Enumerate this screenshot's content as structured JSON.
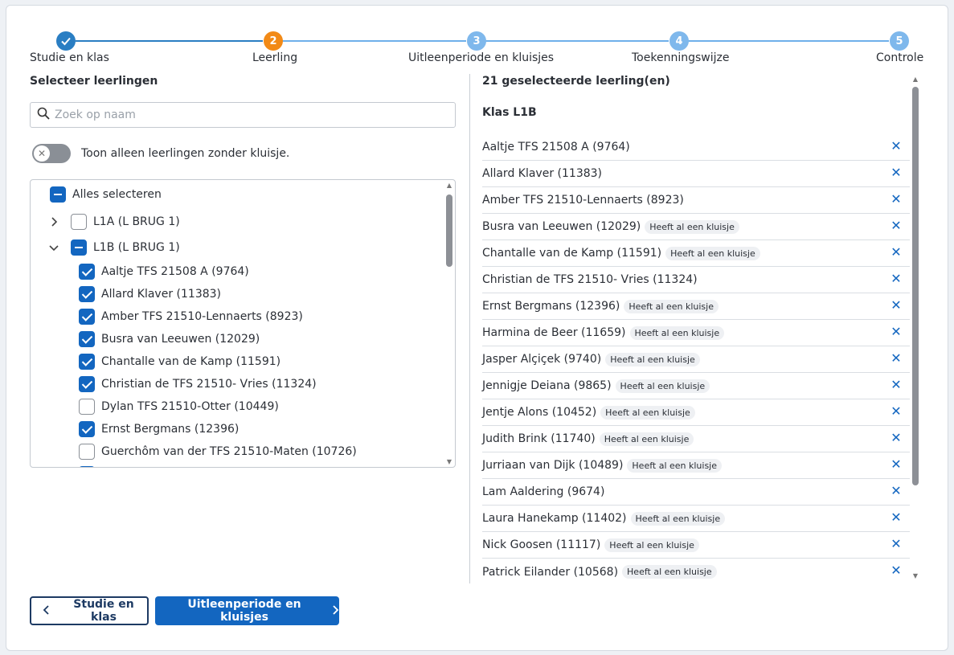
{
  "stepper": {
    "steps": [
      {
        "num": "",
        "label": "Studie en klas",
        "state": "done"
      },
      {
        "num": "2",
        "label": "Leerling",
        "state": "current"
      },
      {
        "num": "3",
        "label": "Uitleenperiode en kluisjes",
        "state": "todo"
      },
      {
        "num": "4",
        "label": "Toekenningswijze",
        "state": "todo"
      },
      {
        "num": "5",
        "label": "Controle",
        "state": "todo"
      }
    ]
  },
  "left": {
    "title": "Selecteer leerlingen",
    "search_placeholder": "Zoek op naam",
    "toggle_label": "Toon alleen leerlingen zonder kluisje.",
    "select_all": "Alles selecteren",
    "groups": [
      {
        "label": "L1A (L BRUG 1)",
        "expanded": false,
        "state": "unchecked"
      },
      {
        "label": "L1B (L BRUG 1)",
        "expanded": true,
        "state": "partial"
      }
    ],
    "students": [
      {
        "label": "Aaltje TFS 21508 A (9764)",
        "checked": true
      },
      {
        "label": "Allard Klaver (11383)",
        "checked": true
      },
      {
        "label": "Amber TFS 21510-Lennaerts (8923)",
        "checked": true
      },
      {
        "label": "Busra van Leeuwen (12029)",
        "checked": true
      },
      {
        "label": "Chantalle van de Kamp (11591)",
        "checked": true
      },
      {
        "label": "Christian de TFS 21510- Vries (11324)",
        "checked": true
      },
      {
        "label": "Dylan TFS 21510-Otter (10449)",
        "checked": false
      },
      {
        "label": "Ernst Bergmans (12396)",
        "checked": true
      },
      {
        "label": "Guerchôm van der TFS 21510-Maten (10726)",
        "checked": false
      }
    ]
  },
  "right": {
    "title": "21 geselecteerde leerling(en)",
    "class_title": "Klas L1B",
    "badge_text": "Heeft al een kluisje",
    "selected": [
      {
        "name": "Aaltje TFS 21508 A (9764)",
        "badge": false
      },
      {
        "name": "Allard Klaver (11383)",
        "badge": false
      },
      {
        "name": "Amber TFS 21510-Lennaerts (8923)",
        "badge": false
      },
      {
        "name": "Busra van Leeuwen (12029)",
        "badge": true
      },
      {
        "name": "Chantalle van de Kamp (11591)",
        "badge": true
      },
      {
        "name": "Christian de TFS 21510- Vries (11324)",
        "badge": false
      },
      {
        "name": "Ernst Bergmans (12396)",
        "badge": true
      },
      {
        "name": "Harmina de Beer (11659)",
        "badge": true
      },
      {
        "name": "Jasper Alçiçek (9740)",
        "badge": true
      },
      {
        "name": "Jennigje Deiana (9865)",
        "badge": true
      },
      {
        "name": "Jentje Alons (10452)",
        "badge": true
      },
      {
        "name": "Judith Brink (11740)",
        "badge": true
      },
      {
        "name": "Jurriaan van Dijk (10489)",
        "badge": true
      },
      {
        "name": "Lam Aaldering (9674)",
        "badge": false
      },
      {
        "name": "Laura Hanekamp (11402)",
        "badge": true
      },
      {
        "name": "Nick Goosen (11117)",
        "badge": true
      },
      {
        "name": "Patrick Eilander (10568)",
        "badge": true
      }
    ]
  },
  "buttons": {
    "back": "Studie en klas",
    "next": "Uitleenperiode en kluisjes"
  },
  "colors": {
    "primary": "#1366c0",
    "current_step": "#f28a17",
    "dark_navy": "#1d3a63"
  },
  "icons": {
    "search": "search-icon",
    "remove": "close-icon",
    "back": "chevron-left-icon",
    "next": "chevron-right-icon"
  }
}
